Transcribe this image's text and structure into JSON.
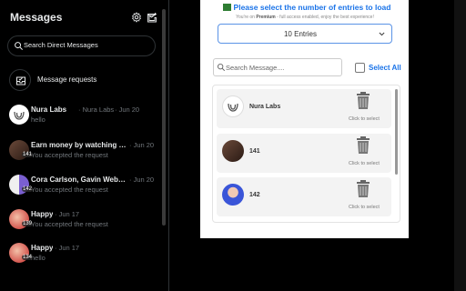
{
  "messages": {
    "title": "Messages",
    "search_placeholder": "Search Direct Messages",
    "requests_label": "Message requests",
    "conversations": [
      {
        "name": "Nura Labs",
        "handle": "· Nura Labs",
        "date": "· Jun 20",
        "preview": "hello",
        "badge": ""
      },
      {
        "name": "Earn money by watching vide...",
        "handle": "",
        "date": "· Jun 20",
        "preview": "You accepted the request",
        "badge": "141"
      },
      {
        "name": "Cora Carlson, Gavin Weber | B...",
        "handle": "",
        "date": "· Jun 20",
        "preview": "You accepted the request",
        "badge": "142"
      },
      {
        "name": "Happy",
        "handle": "",
        "date": "· Jun 17",
        "preview": "You accepted the request",
        "badge": "139"
      },
      {
        "name": "Happy",
        "handle": "",
        "date": "· Jun 17",
        "preview": "hello",
        "badge": "134"
      }
    ]
  },
  "popup": {
    "title": "Please select the number of entries to load",
    "subtitle_prefix": "You're on ",
    "subtitle_plan": "Premium",
    "subtitle_suffix": " - full access enabled, enjoy the best experience!",
    "entries_value": "10 Entries",
    "search_placeholder": "Search Message....",
    "select_all_label": "Select All",
    "cards": [
      {
        "name": "Nura Labs",
        "hint": "Click to select"
      },
      {
        "name": "141",
        "hint": "Click to select"
      },
      {
        "name": "142",
        "hint": "Click to select"
      }
    ]
  },
  "colors": {
    "accent_blue": "#1a73e8",
    "panel_bg": "#000000",
    "text_primary": "#e7e9ea",
    "text_secondary": "#71767b"
  }
}
